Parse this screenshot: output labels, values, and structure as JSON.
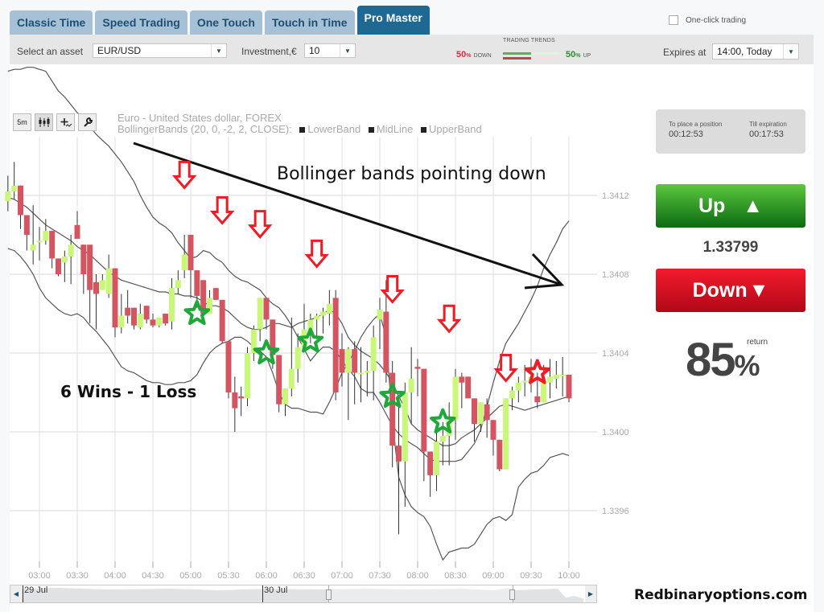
{
  "tabs": [
    {
      "label": "Classic Time",
      "active": false
    },
    {
      "label": "Speed Trading",
      "active": false
    },
    {
      "label": "One Touch",
      "active": false
    },
    {
      "label": "Touch in Time",
      "active": false
    },
    {
      "label": "Pro Master",
      "active": true
    }
  ],
  "one_click": {
    "label": "One-click trading",
    "checked": false
  },
  "toolbar": {
    "asset_label": "Select an asset",
    "asset_value": "EUR/USD",
    "investment_label": "Investment,€",
    "investment_value": "10",
    "trends_title": "TRADING TRENDS",
    "down_pct": "50",
    "down_word": "DOWN",
    "up_pct": "50",
    "up_word": "UP",
    "pct_sign": "%",
    "trend_down_fraction": 0.5,
    "trend_up_fraction": 0.5,
    "expires_label": "Expires at",
    "expires_value": "14:00, Today"
  },
  "chart_tools": {
    "period": "5m"
  },
  "info": {
    "place_label": "To place a position",
    "place_value": "00:12:53",
    "till_label": "Till expiration",
    "till_value": "00:17:53"
  },
  "trade": {
    "up_label": "Up",
    "down_label": "Down",
    "current_price": "1.33799",
    "return_value": "85",
    "return_pct": "%",
    "return_label": "return"
  },
  "navigator": {
    "date1": "29 Jul",
    "date2": "30 Jul"
  },
  "annotations": {
    "headline": "Bollinger bands pointing down",
    "score": "6 Wins - 1 Loss",
    "brand": "Redbinaryoptions.com"
  },
  "colors": {
    "bull": "#c8f77a",
    "bear": "#d35561",
    "win": "#1fa83a",
    "loss": "#ee1c25",
    "arrow": "#ee1c25"
  },
  "chart_data": {
    "type": "candlestick",
    "title": "Euro - United States dollar, FOREX",
    "subtitle": "BollingerBands (20, 0, -2, 2, CLOSE):",
    "legend": [
      "LowerBand",
      "MidLine",
      "UpperBand"
    ],
    "interval": "5m",
    "x_ticks": [
      "03:00",
      "03:30",
      "04:00",
      "04:30",
      "05:00",
      "05:30",
      "06:00",
      "06:30",
      "07:00",
      "07:30",
      "08:00",
      "08:30",
      "09:00",
      "09:30",
      "10:00"
    ],
    "y_ticks": [
      "1.3412",
      "1.3408",
      "1.3404",
      "1.3400",
      "1.3396"
    ],
    "ylim": [
      1.33935,
      1.3416
    ],
    "grid": true,
    "start_time": "02:35",
    "candles": [
      [
        1.34117,
        1.3413,
        1.34112,
        1.34122
      ],
      [
        1.34122,
        1.34137,
        1.34118,
        1.34125
      ],
      [
        1.34125,
        1.34125,
        1.34103,
        1.3411
      ],
      [
        1.3411,
        1.3411,
        1.34092,
        1.341
      ],
      [
        1.34092,
        1.34115,
        1.34085,
        1.34095
      ],
      [
        1.34097,
        1.34104,
        1.34087,
        1.34097
      ],
      [
        1.34097,
        1.34108,
        1.34095,
        1.34102
      ],
      [
        1.34102,
        1.34102,
        1.34083,
        1.34088
      ],
      [
        1.34088,
        1.34088,
        1.34079,
        1.3408
      ],
      [
        1.34086,
        1.34092,
        1.34076,
        1.34089
      ],
      [
        1.34089,
        1.341,
        1.34075,
        1.34095
      ],
      [
        1.34105,
        1.34112,
        1.34102,
        1.34098
      ],
      [
        1.34095,
        1.34095,
        1.3407,
        1.3408
      ],
      [
        1.34095,
        1.3408,
        1.34055,
        1.34072
      ],
      [
        1.34076,
        1.3408,
        1.34052,
        1.3407
      ],
      [
        1.34072,
        1.3408,
        1.34072,
        1.34077
      ],
      [
        1.3407,
        1.3409,
        1.34068,
        1.34083
      ],
      [
        1.34083,
        1.34083,
        1.34048,
        1.34053
      ],
      [
        1.34053,
        1.3407,
        1.3405,
        1.34059
      ],
      [
        1.34063,
        1.34072,
        1.34055,
        1.34059
      ],
      [
        1.34063,
        1.34063,
        1.34052,
        1.34054
      ],
      [
        1.34053,
        1.34065,
        1.34052,
        1.3406
      ],
      [
        1.34064,
        1.34064,
        1.34055,
        1.34057
      ],
      [
        1.34057,
        1.3406,
        1.34053,
        1.34054
      ],
      [
        1.34054,
        1.34058,
        1.34053,
        1.34058
      ],
      [
        1.3406,
        1.3406,
        1.34054,
        1.34055
      ],
      [
        1.34056,
        1.34078,
        1.34052,
        1.34073
      ],
      [
        1.34073,
        1.34082,
        1.3407,
        1.34077
      ],
      [
        1.34082,
        1.341,
        1.34078,
        1.3409
      ],
      [
        1.341,
        1.341,
        1.34068,
        1.34082
      ],
      [
        1.34082,
        1.34082,
        1.34063,
        1.34069
      ],
      [
        1.34077,
        1.34077,
        1.34055,
        1.3406
      ],
      [
        1.3406,
        1.34072,
        1.3406,
        1.34068
      ],
      [
        1.34073,
        1.34073,
        1.34067,
        1.34067
      ],
      [
        1.34067,
        1.34067,
        1.34045,
        1.34046
      ],
      [
        1.34046,
        1.34046,
        1.34017,
        1.3402
      ],
      [
        1.3402,
        1.34028,
        1.34,
        1.34012
      ],
      [
        1.34018,
        1.34023,
        1.34008,
        1.34017
      ],
      [
        1.34017,
        1.34043,
        1.34013,
        1.3404
      ],
      [
        1.3404,
        1.34054,
        1.34036,
        1.34052
      ],
      [
        1.34052,
        1.34068,
        1.34046,
        1.34068
      ],
      [
        1.34068,
        1.34068,
        1.34052,
        1.34057
      ],
      [
        1.34057,
        1.34057,
        1.34032,
        1.34039
      ],
      [
        1.34039,
        1.34039,
        1.3401,
        1.34014
      ],
      [
        1.34014,
        1.34022,
        1.34008,
        1.34022
      ],
      [
        1.34022,
        1.34058,
        1.34018,
        1.34032
      ],
      [
        1.34032,
        1.3405,
        1.34025,
        1.34043
      ],
      [
        1.34043,
        1.34065,
        1.34043,
        1.34052
      ],
      [
        1.34052,
        1.3406,
        1.34045,
        1.34057
      ],
      [
        1.34057,
        1.3406,
        1.34047,
        1.34059
      ],
      [
        1.34059,
        1.34063,
        1.3405,
        1.34061
      ],
      [
        1.3406,
        1.34072,
        1.34054,
        1.34065
      ],
      [
        1.34068,
        1.34072,
        1.34016,
        1.3402
      ],
      [
        1.34042,
        1.3405,
        1.34023,
        1.3403
      ],
      [
        1.3403,
        1.34043,
        1.34006,
        1.34042
      ],
      [
        1.34042,
        1.34046,
        1.34014,
        1.3403
      ],
      [
        1.3403,
        1.34043,
        1.34015,
        1.3403
      ],
      [
        1.3403,
        1.34036,
        1.34018,
        1.34031
      ],
      [
        1.34031,
        1.34054,
        1.34016,
        1.34048
      ],
      [
        1.34057,
        1.34068,
        1.34042,
        1.34062
      ],
      [
        1.34061,
        1.34077,
        1.34025,
        1.3403
      ],
      [
        1.3403,
        1.34036,
        1.33982,
        1.33993
      ],
      [
        1.33993,
        1.34014,
        1.33948,
        1.33985
      ],
      [
        1.33985,
        1.34025,
        1.33962,
        1.3402
      ],
      [
        1.3402,
        1.34043,
        1.34004,
        1.34027
      ],
      [
        1.34033,
        1.34037,
        1.34018,
        1.34032
      ],
      [
        1.34032,
        1.34032,
        1.33975,
        1.3399
      ],
      [
        1.3399,
        1.3399,
        1.33967,
        1.33978
      ],
      [
        1.33978,
        1.34002,
        1.3397,
        1.33995
      ],
      [
        1.33995,
        1.34005,
        1.33983,
        1.33998
      ],
      [
        1.33998,
        1.34015,
        1.33983,
        1.34006
      ],
      [
        1.34006,
        1.34032,
        1.33996,
        1.34028
      ],
      [
        1.34028,
        1.3403,
        1.34012,
        1.34025
      ],
      [
        1.34028,
        1.34028,
        1.34018,
        1.34017
      ],
      [
        1.34017,
        1.34017,
        1.33995,
        1.34004
      ],
      [
        1.34004,
        1.34015,
        1.34,
        1.34015
      ],
      [
        1.34014,
        1.34017,
        1.33997,
        1.34006
      ],
      [
        1.34006,
        1.34006,
        1.33988,
        1.33996
      ],
      [
        1.33996,
        1.33996,
        1.3398,
        1.33981
      ],
      [
        1.33981,
        1.34017,
        1.33981,
        1.34017
      ],
      [
        1.34017,
        1.34023,
        1.34011,
        1.34021
      ],
      [
        1.34021,
        1.34028,
        1.34015,
        1.34025
      ],
      [
        1.34025,
        1.34034,
        1.34018,
        1.34026
      ],
      [
        1.34026,
        1.34037,
        1.3402,
        1.34028
      ],
      [
        1.34018,
        1.3403,
        1.34012,
        1.34015
      ],
      [
        1.34015,
        1.34034,
        1.34015,
        1.34025
      ],
      [
        1.34025,
        1.34037,
        1.34017,
        1.34028
      ],
      [
        1.34027,
        1.34036,
        1.34022,
        1.34029
      ],
      [
        1.34029,
        1.34038,
        1.34018,
        1.34029
      ],
      [
        1.34029,
        1.34029,
        1.34015,
        1.34017
      ]
    ],
    "upper_band": [
      1.34183,
      1.34184,
      1.34184,
      1.34185,
      1.34185,
      1.34184,
      1.34183,
      1.34178,
      1.34173,
      1.3417,
      1.34166,
      1.34162,
      1.34159,
      1.34155,
      1.34151,
      1.34148,
      1.34145,
      1.34141,
      1.34137,
      1.34132,
      1.34127,
      1.3412,
      1.34114,
      1.34109,
      1.34106,
      1.34104,
      1.34101,
      1.34096,
      1.34092,
      1.34088,
      1.34089,
      1.34092,
      1.34091,
      1.34088,
      1.34086,
      1.34082,
      1.34079,
      1.34077,
      1.34076,
      1.34074,
      1.34072,
      1.34068,
      1.34065,
      1.34063,
      1.34059,
      1.34054,
      1.34048,
      1.34042,
      1.34036,
      1.3404,
      1.34043,
      1.34043,
      1.34041,
      1.34036,
      1.34032,
      1.34028,
      1.34022,
      1.3402,
      1.3402,
      1.34015,
      1.34009,
      1.34003,
      1.33999,
      1.33996,
      1.33994,
      1.33992,
      1.33989,
      1.33986,
      1.33985,
      1.33985,
      1.33985,
      1.33985,
      1.33986,
      1.3399,
      1.33994,
      1.34001,
      1.34013,
      1.34025,
      1.34036,
      1.34045,
      1.3405,
      1.34055,
      1.34061,
      1.34067,
      1.34074,
      1.34083,
      1.3409,
      1.34096,
      1.34103,
      1.34107
    ],
    "mid_line": [
      1.34119,
      1.34118,
      1.34116,
      1.34114,
      1.34111,
      1.34108,
      1.34105,
      1.34103,
      1.34101,
      1.34099,
      1.34097,
      1.34094,
      1.34092,
      1.3409,
      1.34087,
      1.34084,
      1.34081,
      1.34079,
      1.34077,
      1.34076,
      1.34075,
      1.34074,
      1.34073,
      1.34072,
      1.34071,
      1.34071,
      1.3407,
      1.3407,
      1.34069,
      1.34069,
      1.34068,
      1.34066,
      1.34064,
      1.34064,
      1.34063,
      1.34061,
      1.34058,
      1.34055,
      1.34053,
      1.34052,
      1.34052,
      1.34053,
      1.34055,
      1.34055,
      1.34054,
      1.34053,
      1.34055,
      1.34056,
      1.34057,
      1.34058,
      1.3406,
      1.34062,
      1.3406,
      1.34055,
      1.34048,
      1.34044,
      1.34041,
      1.34039,
      1.34037,
      1.34034,
      1.3403,
      1.34025,
      1.34018,
      1.34012,
      1.34004,
      1.34001,
      1.33999,
      1.33997,
      1.33995,
      1.33993,
      1.33993,
      1.33994,
      1.33997,
      1.33999,
      1.34001,
      1.34004,
      1.34007,
      1.3401,
      1.34013,
      1.34014,
      1.34013,
      1.34012,
      1.34011,
      1.34012,
      1.34013,
      1.34014,
      1.34015,
      1.34016,
      1.34017,
      1.34018
    ],
    "lower_band": [
      1.34093,
      1.34092,
      1.34089,
      1.34085,
      1.3408,
      1.34073,
      1.34068,
      1.34065,
      1.34062,
      1.3406,
      1.34059,
      1.3406,
      1.34058,
      1.34054,
      1.34051,
      1.34047,
      1.34043,
      1.34038,
      1.34033,
      1.34031,
      1.3403,
      1.34028,
      1.34026,
      1.34025,
      1.34025,
      1.34024,
      1.34024,
      1.34025,
      1.34025,
      1.34026,
      1.34029,
      1.34035,
      1.3404,
      1.34043,
      1.34045,
      1.34046,
      1.34048,
      1.34048,
      1.34046,
      1.34043,
      1.34041,
      1.34038,
      1.3403,
      1.3402,
      1.34014,
      1.34012,
      1.34012,
      1.34011,
      1.3401,
      1.3401,
      1.34009,
      1.34015,
      1.34022,
      1.3403,
      1.34035,
      1.34041,
      1.34048,
      1.34053,
      1.34057,
      1.3406,
      1.34048,
      1.34005,
      1.33977,
      1.33968,
      1.33962,
      1.33959,
      1.33957,
      1.33952,
      1.33943,
      1.33935,
      1.33939,
      1.3394,
      1.33941,
      1.33941,
      1.33943,
      1.33948,
      1.33953,
      1.33956,
      1.33957,
      1.33955,
      1.33958,
      1.33972,
      1.33976,
      1.33979,
      1.3398,
      1.33983,
      1.33987,
      1.33988,
      1.33989,
      1.33988
    ],
    "signals": [
      {
        "type": "down-arrow",
        "candle": 28,
        "price": 1.34128
      },
      {
        "type": "down-arrow",
        "candle": 34,
        "price": 1.3411
      },
      {
        "type": "down-arrow",
        "candle": 40,
        "price": 1.34103
      },
      {
        "type": "down-arrow",
        "candle": 49,
        "price": 1.34088
      },
      {
        "type": "down-arrow",
        "candle": 61,
        "price": 1.3407
      },
      {
        "type": "down-arrow",
        "candle": 70,
        "price": 1.34055
      },
      {
        "type": "down-arrow",
        "candle": 79,
        "price": 1.3403
      },
      {
        "type": "win-star",
        "candle": 30,
        "price": 1.3406
      },
      {
        "type": "win-star",
        "candle": 41,
        "price": 1.3404
      },
      {
        "type": "win-star",
        "candle": 48,
        "price": 1.34046
      },
      {
        "type": "win-star",
        "candle": 61,
        "price": 1.34018
      },
      {
        "type": "win-star",
        "candle": 69,
        "price": 1.34005
      },
      {
        "type": "loss-star",
        "candle": 84,
        "price": 1.3403
      }
    ]
  }
}
